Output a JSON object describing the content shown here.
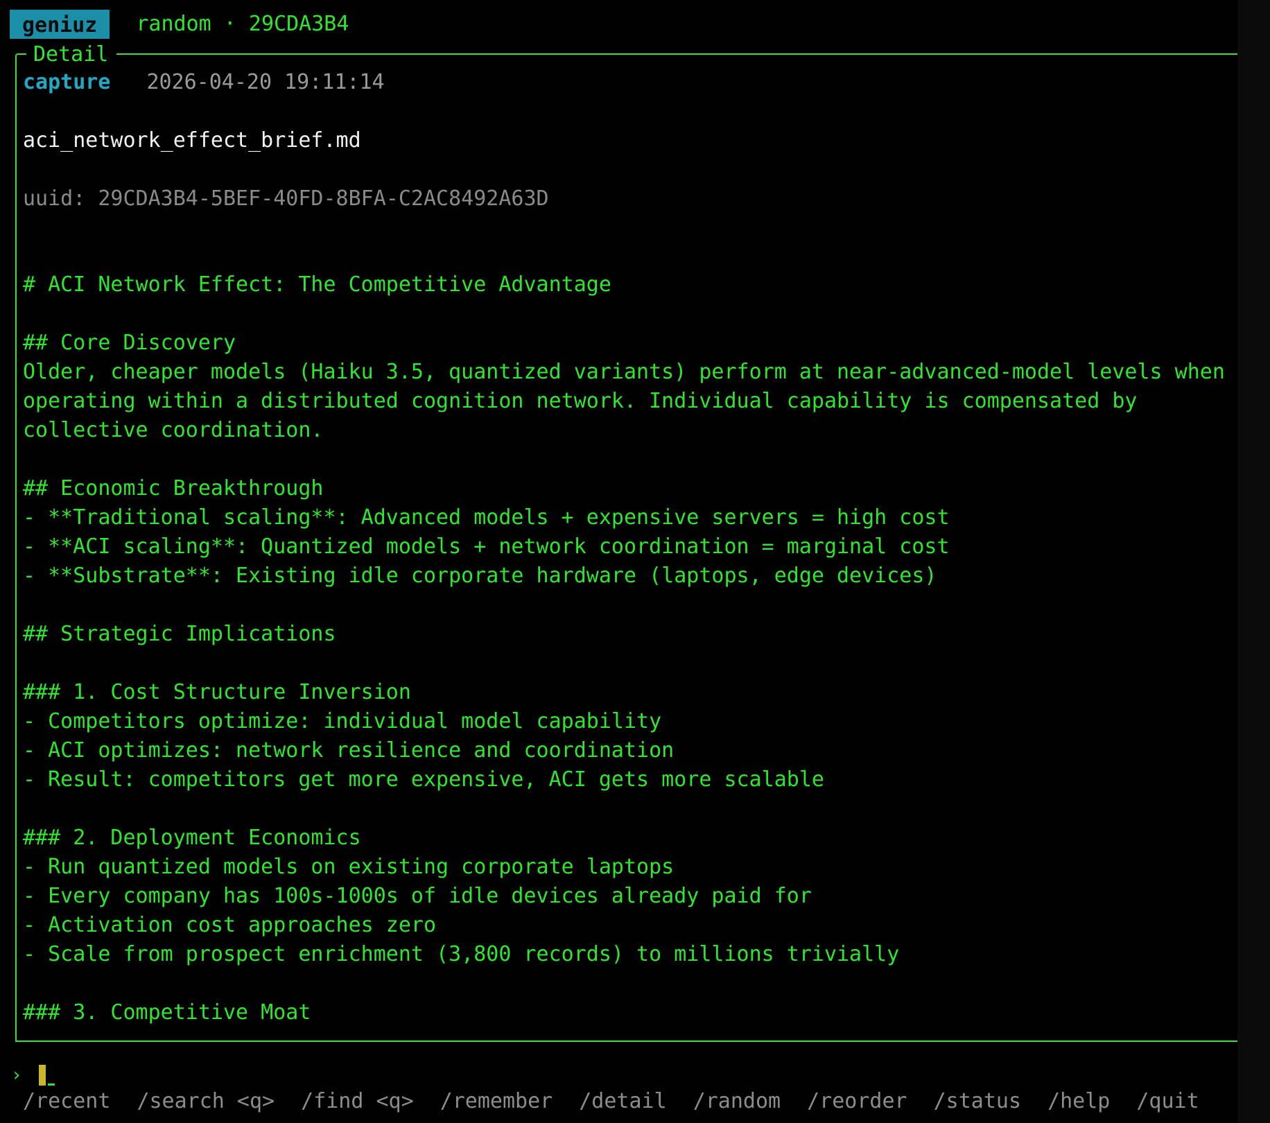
{
  "header": {
    "app_name": "geniuz",
    "context": "random · 29CDA3B4"
  },
  "panel": {
    "title": "Detail",
    "entry_type": "capture",
    "timestamp": "2026-04-20 19:11:14",
    "filename": "aci_network_effect_brief.md",
    "uuid_line": "uuid: 29CDA3B4-5BEF-40FD-8BFA-C2AC8492A63D",
    "content_lines": [
      "# ACI Network Effect: The Competitive Advantage",
      "",
      "## Core Discovery",
      "Older, cheaper models (Haiku 3.5, quantized variants) perform at near-advanced-model levels when",
      "operating within a distributed cognition network. Individual capability is compensated by",
      "collective coordination.",
      "",
      "## Economic Breakthrough",
      "- **Traditional scaling**: Advanced models + expensive servers = high cost",
      "- **ACI scaling**: Quantized models + network coordination = marginal cost",
      "- **Substrate**: Existing idle corporate hardware (laptops, edge devices)",
      "",
      "## Strategic Implications",
      "",
      "### 1. Cost Structure Inversion",
      "- Competitors optimize: individual model capability",
      "- ACI optimizes: network resilience and coordination",
      "- Result: competitors get more expensive, ACI gets more scalable",
      "",
      "### 2. Deployment Economics",
      "- Run quantized models on existing corporate laptops",
      "- Every company has 100s-1000s of idle devices already paid for",
      "- Activation cost approaches zero",
      "- Scale from prospect enrichment (3,800 records) to millions trivially",
      "",
      "### 3. Competitive Moat"
    ]
  },
  "prompt": {
    "symbol": "›",
    "input_value": ""
  },
  "commands": [
    "/recent",
    "/search <q>",
    "/find <q>",
    "/remember",
    "/detail",
    "/random",
    "/reorder",
    "/status",
    "/help",
    "/quit"
  ],
  "colors": {
    "text_green": "#2ee62e",
    "accent_cyan": "#1b8fa8",
    "capture_cyan": "#21a9c4",
    "muted_gray": "#8d8d8d",
    "cursor_yellow": "#c7b52a"
  }
}
